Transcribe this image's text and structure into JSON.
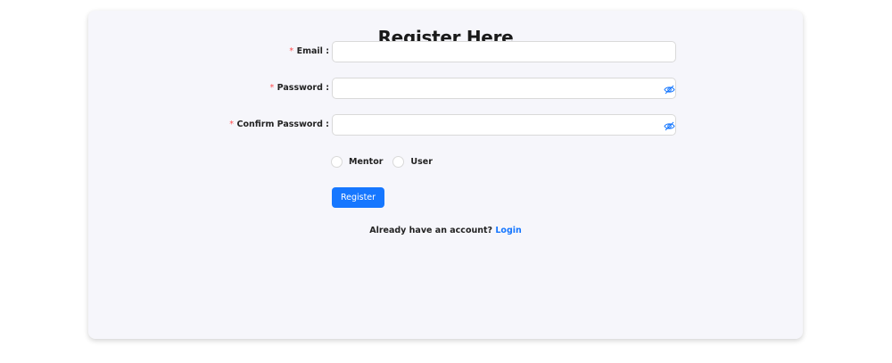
{
  "form": {
    "title": "Register Here",
    "email_label": "Email :",
    "password_label": "Password :",
    "confirm_password_label": "Confirm Password :",
    "required_mark": "*",
    "email_value": "",
    "password_value": "",
    "confirm_password_value": "",
    "roles": [
      "Mentor",
      "User"
    ],
    "submit_label": "Register",
    "footer_text": "Already have an account?",
    "footer_link": "Login"
  },
  "colors": {
    "primary": "#1677ff",
    "card_background": "#f6f6fb",
    "required": "#ff4d4f"
  },
  "icons": {
    "password_toggle": "eye-invisible-icon"
  }
}
